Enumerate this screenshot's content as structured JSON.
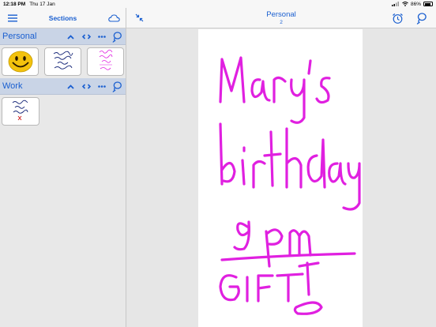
{
  "status_bar": {
    "time": "12:18 PM",
    "date": "Thu 17 Jan",
    "battery": "86%",
    "battery_level": 0.86
  },
  "sidebar": {
    "title": "Sections",
    "icons": {
      "menu": "hamburger-menu-icon",
      "cloud": "cloud-icon"
    },
    "sections": [
      {
        "name": "Personal",
        "controls": [
          "chevron-up-icon",
          "code-brackets-icon",
          "ellipsis-icon",
          "lasso-icon"
        ],
        "notes": [
          {
            "name": "smiley-face-note"
          },
          {
            "name": "handwritten-note"
          },
          {
            "name": "marys-birthday-note",
            "selected": true
          }
        ]
      },
      {
        "name": "Work",
        "controls": [
          "chevron-up-icon",
          "code-brackets-icon",
          "ellipsis-icon",
          "lasso-icon"
        ],
        "notes": [
          {
            "name": "work-report-note"
          }
        ]
      }
    ]
  },
  "main": {
    "title": "Personal",
    "page_number": "2",
    "icons": {
      "collapse": "collapse-arrows-icon",
      "alarm": "alarm-clock-icon",
      "lasso": "lasso-icon"
    }
  },
  "colors": {
    "accent": "#1a5fd0",
    "section_header_bg": "#c9d4e6",
    "ink": "#e020e0"
  }
}
